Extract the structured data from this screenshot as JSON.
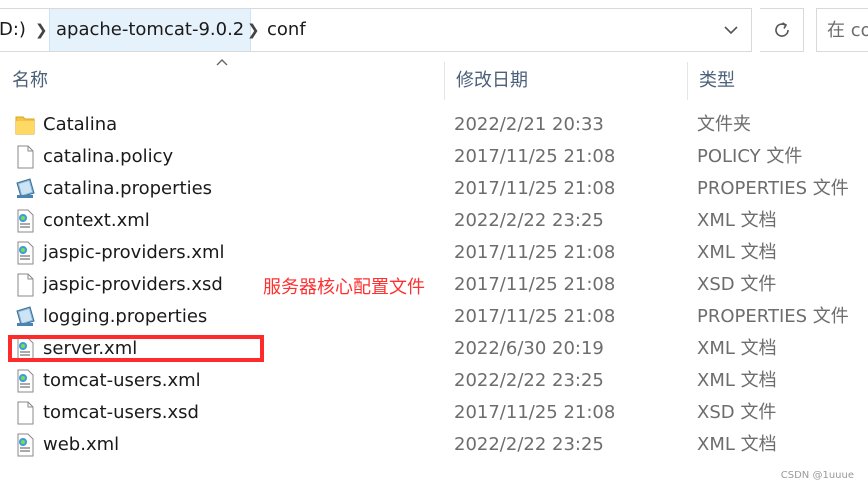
{
  "address_bar": {
    "crumb_root": "D:)",
    "crumb_folder": "apache-tomcat-9.0.2",
    "crumb_current": "conf",
    "search_placeholder": "在 co"
  },
  "columns": {
    "name": "名称",
    "date": "修改日期",
    "type": "类型"
  },
  "files": [
    {
      "name": "Catalina",
      "date": "2022/2/21 20:33",
      "type": "文件夹",
      "icon": "folder-icon"
    },
    {
      "name": "catalina.policy",
      "date": "2017/11/25 21:08",
      "type": "POLICY 文件",
      "icon": "blank-file-icon"
    },
    {
      "name": "catalina.properties",
      "date": "2017/11/25 21:08",
      "type": "PROPERTIES 文件",
      "icon": "properties-file-icon"
    },
    {
      "name": "context.xml",
      "date": "2022/2/22 23:25",
      "type": "XML 文档",
      "icon": "xml-file-icon"
    },
    {
      "name": "jaspic-providers.xml",
      "date": "2017/11/25 21:08",
      "type": "XML 文档",
      "icon": "xml-file-icon"
    },
    {
      "name": "jaspic-providers.xsd",
      "date": "2017/11/25 21:08",
      "type": "XSD 文件",
      "icon": "blank-file-icon"
    },
    {
      "name": "logging.properties",
      "date": "2017/11/25 21:08",
      "type": "PROPERTIES 文件",
      "icon": "properties-file-icon"
    },
    {
      "name": "server.xml",
      "date": "2022/6/30 20:19",
      "type": "XML 文档",
      "icon": "xml-file-icon"
    },
    {
      "name": "tomcat-users.xml",
      "date": "2022/2/22 23:25",
      "type": "XML 文档",
      "icon": "xml-file-icon"
    },
    {
      "name": "tomcat-users.xsd",
      "date": "2017/11/25 21:08",
      "type": "XSD 文件",
      "icon": "blank-file-icon"
    },
    {
      "name": "web.xml",
      "date": "2022/2/22 23:25",
      "type": "XML 文档",
      "icon": "xml-file-icon"
    }
  ],
  "annotation": "服务器核心配置文件",
  "highlighted_file": "server.xml",
  "watermark": "CSDN @1uuue",
  "colors": {
    "annotation": "#ff3030",
    "highlight_border": "#ff2a2a",
    "header_text": "#4c607a",
    "secondary_text": "#6d6d6d",
    "folder": "#f5c542"
  }
}
